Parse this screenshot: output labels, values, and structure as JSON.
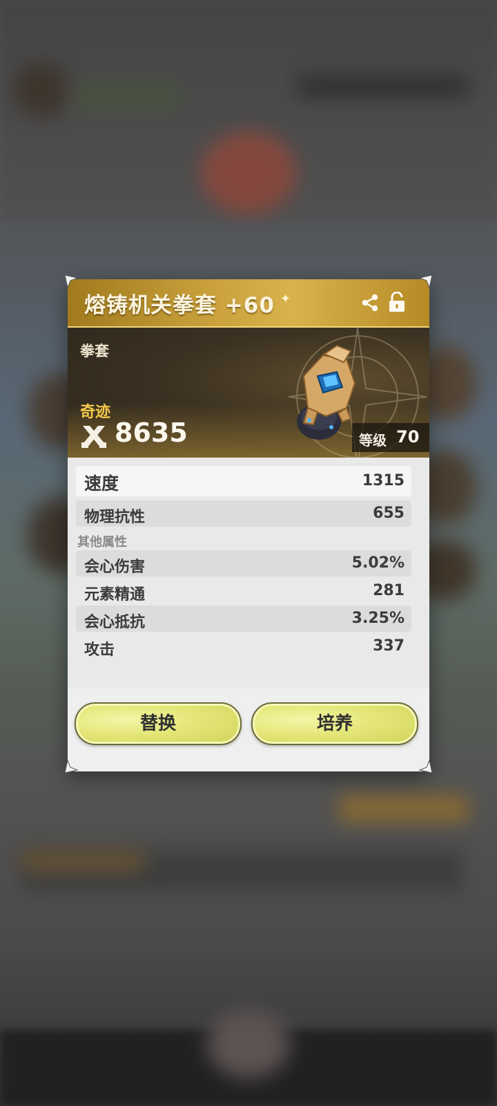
{
  "item": {
    "name": "熔铸机关拳套 +60",
    "category": "拳套",
    "rarity": "奇迹",
    "power": "8635",
    "level_label": "等级",
    "level_value": "70"
  },
  "icons": {
    "share": "share-icon",
    "lock": "unlock-icon",
    "power": "crossed-weapons-icon"
  },
  "main_stats": [
    {
      "label": "速度",
      "value": "1315"
    },
    {
      "label": "物理抗性",
      "value": "655"
    }
  ],
  "other_stats_title": "其他属性",
  "other_stats": [
    {
      "label": "会心伤害",
      "value": "5.02%"
    },
    {
      "label": "元素精通",
      "value": "281"
    },
    {
      "label": "会心抵抗",
      "value": "3.25%"
    },
    {
      "label": "攻击",
      "value": "337"
    }
  ],
  "buttons": {
    "replace": "替换",
    "upgrade": "培养"
  },
  "colors": {
    "header_gold": "#caa13c",
    "rarity_gold": "#f4c84a",
    "button_yellow": "#e4e677"
  }
}
